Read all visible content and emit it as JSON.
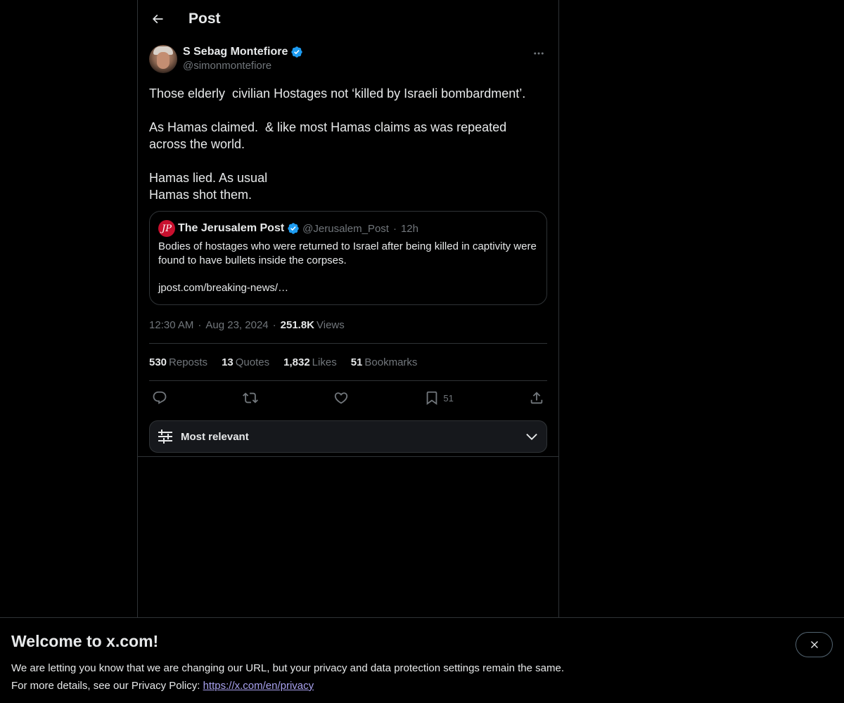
{
  "header": {
    "title": "Post"
  },
  "post": {
    "author_name": "S Sebag Montefiore",
    "author_handle": "@simonmontefiore",
    "text": "Those elderly  civilian Hostages not ‘killed by Israeli bombardment’.\n\nAs Hamas claimed.  & like most Hamas claims as was repeated across the world.\n\nHamas lied. As usual\nHamas shot them.",
    "time": "12:30 AM",
    "date": "Aug 23, 2024",
    "views_count": "251.8K",
    "views_label": "Views"
  },
  "quote": {
    "logo_text": "JP",
    "name": "The Jerusalem Post",
    "handle": "@Jerusalem_Post",
    "dot": "·",
    "time": "12h",
    "text": "Bodies of hostages who were returned to Israel after being killed in captivity were found to have bullets inside the corpses.",
    "link": "jpost.com/breaking-news/…"
  },
  "stats": {
    "reposts_count": "530",
    "reposts_label": "Reposts",
    "quotes_count": "13",
    "quotes_label": "Quotes",
    "likes_count": "1,832",
    "likes_label": "Likes",
    "bookmarks_count": "51",
    "bookmarks_label": "Bookmarks"
  },
  "actions": {
    "bookmark_count": "51"
  },
  "sort": {
    "label": "Most relevant"
  },
  "banner": {
    "title": "Welcome to x.com!",
    "line1": "We are letting you know that we are changing our URL, but your privacy and data protection settings remain the same.",
    "line2_prefix": "For more details, see our Privacy Policy: ",
    "link": "https://x.com/en/privacy"
  },
  "colors": {
    "background": "#000000",
    "text_primary": "#e7e9ea",
    "text_secondary": "#71767b",
    "border": "#2f3336",
    "verified_blue": "#1d9bf0",
    "link_purple": "#a9a2f0",
    "jp_red": "#c8102e"
  },
  "icons": [
    "back-arrow-icon",
    "verified-badge-icon",
    "more-icon",
    "reply-icon",
    "repost-icon",
    "like-icon",
    "bookmark-icon",
    "share-icon",
    "filter-sliders-icon",
    "chevron-down-icon",
    "close-icon"
  ]
}
